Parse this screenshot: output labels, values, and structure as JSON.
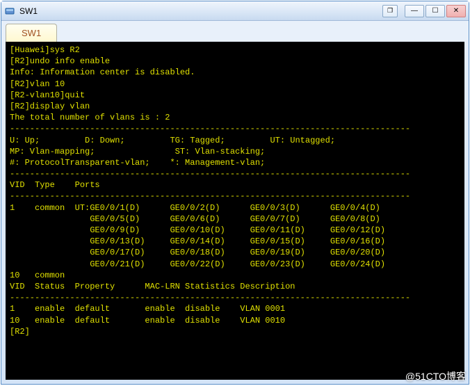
{
  "window": {
    "title": "SW1",
    "icon_name": "app-icon",
    "buttons": {
      "extra": "❐",
      "minimize": "—",
      "maximize": "☐",
      "close": "✕"
    }
  },
  "tabs": [
    {
      "label": "SW1",
      "active": true
    }
  ],
  "terminal": {
    "lines": [
      "[Huawei]sys R2",
      "[R2]undo info enable",
      "Info: Information center is disabled.",
      "[R2]vlan 10",
      "[R2-vlan10]quit",
      "[R2]display vlan",
      "The total number of vlans is : 2",
      "--------------------------------------------------------------------------------",
      "U: Up;         D: Down;         TG: Tagged;         UT: Untagged;",
      "MP: Vlan-mapping;                ST: Vlan-stacking;",
      "#: ProtocolTransparent-vlan;    *: Management-vlan;",
      "--------------------------------------------------------------------------------",
      "",
      "VID  Type    Ports",
      "--------------------------------------------------------------------------------",
      "1    common  UT:GE0/0/1(D)      GE0/0/2(D)      GE0/0/3(D)      GE0/0/4(D)",
      "                GE0/0/5(D)      GE0/0/6(D)      GE0/0/7(D)      GE0/0/8(D)",
      "                GE0/0/9(D)      GE0/0/10(D)     GE0/0/11(D)     GE0/0/12(D)",
      "                GE0/0/13(D)     GE0/0/14(D)     GE0/0/15(D)     GE0/0/16(D)",
      "                GE0/0/17(D)     GE0/0/18(D)     GE0/0/19(D)     GE0/0/20(D)",
      "                GE0/0/21(D)     GE0/0/22(D)     GE0/0/23(D)     GE0/0/24(D)",
      "",
      "10   common",
      "",
      "VID  Status  Property      MAC-LRN Statistics Description",
      "--------------------------------------------------------------------------------",
      "",
      "1    enable  default       enable  disable    VLAN 0001",
      "10   enable  default       enable  disable    VLAN 0010",
      "[R2]"
    ]
  },
  "watermark": "@51CTO博客"
}
